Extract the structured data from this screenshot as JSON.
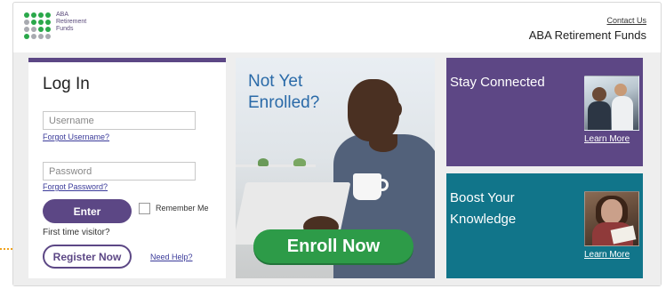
{
  "header": {
    "logo_lines": [
      "ABA",
      "Retirement",
      "Funds"
    ],
    "contact_label": "Contact Us",
    "brand_name": "ABA Retirement Funds"
  },
  "login": {
    "title": "Log In",
    "username_placeholder": "Username",
    "forgot_username": "Forgot Username?",
    "password_placeholder": "Password",
    "forgot_password": "Forgot Password?",
    "enter_label": "Enter",
    "remember_label": "Remember Me",
    "first_time": "First time visitor?",
    "register_label": "Register Now",
    "help_label": "Need Help?"
  },
  "enroll": {
    "title_line1": "Not Yet",
    "title_line2": "Enrolled?",
    "button_label": "Enroll Now"
  },
  "panels": {
    "stay": {
      "title": "Stay Connected",
      "link": "Learn More"
    },
    "boost": {
      "title_line1": "Boost Your",
      "title_line2": "Knowledge",
      "link": "Learn More"
    }
  },
  "colors": {
    "purple": "#5c4785",
    "teal": "#11758a",
    "green": "#2d9b48",
    "blue_heading": "#2a6aa8",
    "highlight": "#f0a21c",
    "logo_green": "#2aa84a",
    "logo_grey": "#a8aab0"
  }
}
